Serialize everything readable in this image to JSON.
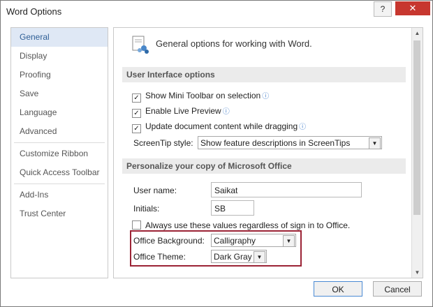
{
  "window": {
    "title": "Word Options",
    "help": "?",
    "close": "✕"
  },
  "nav": {
    "items": [
      "General",
      "Display",
      "Proofing",
      "Save",
      "Language",
      "Advanced",
      "Customize Ribbon",
      "Quick Access Toolbar",
      "Add-Ins",
      "Trust Center"
    ]
  },
  "content": {
    "header": "General options for working with Word.",
    "ui_section": "User Interface options",
    "opt_mini_toolbar": "Show Mini Toolbar on selection",
    "opt_live_preview": "Enable Live Preview",
    "opt_update_drag": "Update document content while dragging",
    "screentip_label": "ScreenTip style:",
    "screentip_value": "Show feature descriptions in ScreenTips",
    "personalize_section": "Personalize your copy of Microsoft Office",
    "username_label": "User name:",
    "username_value": "Saikat",
    "initials_label": "Initials:",
    "initials_value": "SB",
    "always_use": "Always use these values regardless of sign in to Office.",
    "office_bg_label": "Office Background:",
    "office_bg_value": "Calligraphy",
    "office_theme_label": "Office Theme:",
    "office_theme_value": "Dark Gray"
  },
  "footer": {
    "ok": "OK",
    "cancel": "Cancel"
  },
  "colors": {
    "accent": "#2f5f96",
    "highlight_border": "#9b2335",
    "close_bg": "#c7372f"
  }
}
